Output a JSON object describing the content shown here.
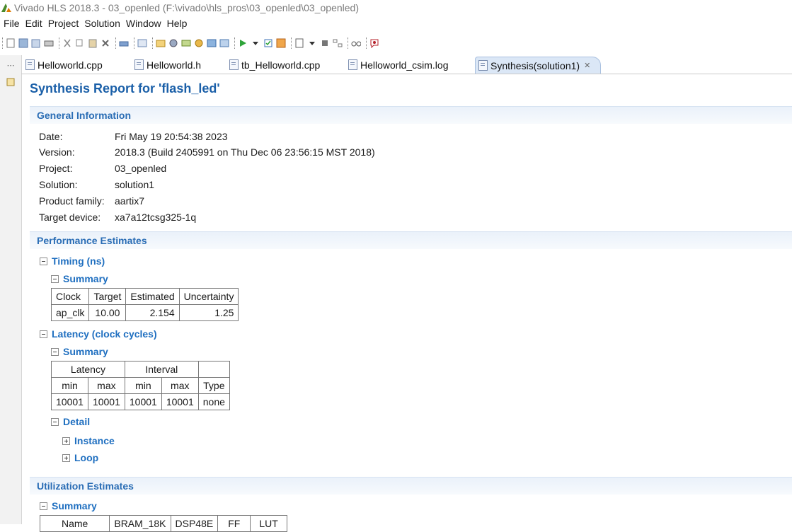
{
  "window": {
    "title": "Vivado HLS 2018.3 - 03_openled (F:\\vivado\\hls_pros\\03_openled\\03_openled)"
  },
  "menu": [
    "File",
    "Edit",
    "Project",
    "Solution",
    "Window",
    "Help"
  ],
  "tabs": [
    "Helloworld.cpp",
    "Helloworld.h",
    "tb_Helloworld.cpp",
    "Helloworld_csim.log",
    "Synthesis(solution1)"
  ],
  "report": {
    "title": "Synthesis Report for 'flash_led'",
    "general": {
      "heading": "General Information",
      "rows": [
        {
          "k": "Date:",
          "v": "Fri May 19 20:54:38 2023"
        },
        {
          "k": "Version:",
          "v": "2018.3 (Build 2405991 on Thu Dec 06 23:56:15 MST 2018)"
        },
        {
          "k": "Project:",
          "v": "03_openled"
        },
        {
          "k": "Solution:",
          "v": "solution1"
        },
        {
          "k": "Product family:",
          "v": "aartix7"
        },
        {
          "k": "Target device:",
          "v": "xa7a12tcsg325-1q"
        }
      ]
    },
    "perf": {
      "heading": "Performance Estimates",
      "timing": "Timing (ns)",
      "summary": "Summary",
      "timing_table": {
        "headers": [
          "Clock",
          "Target",
          "Estimated",
          "Uncertainty"
        ],
        "row": [
          "ap_clk",
          "10.00",
          "2.154",
          "1.25"
        ]
      },
      "latency": "Latency (clock cycles)",
      "latency_table": {
        "group_latency": "Latency",
        "group_interval": "Interval",
        "sub": [
          "min",
          "max",
          "min",
          "max",
          "Type"
        ],
        "row": [
          "10001",
          "10001",
          "10001",
          "10001",
          "none"
        ]
      },
      "detail": "Detail",
      "instance": "Instance",
      "loop": "Loop"
    },
    "util": {
      "heading": "Utilization Estimates",
      "summary": "Summary",
      "headers": [
        "Name",
        "BRAM_18K",
        "DSP48E",
        "FF",
        "LUT"
      ]
    }
  }
}
